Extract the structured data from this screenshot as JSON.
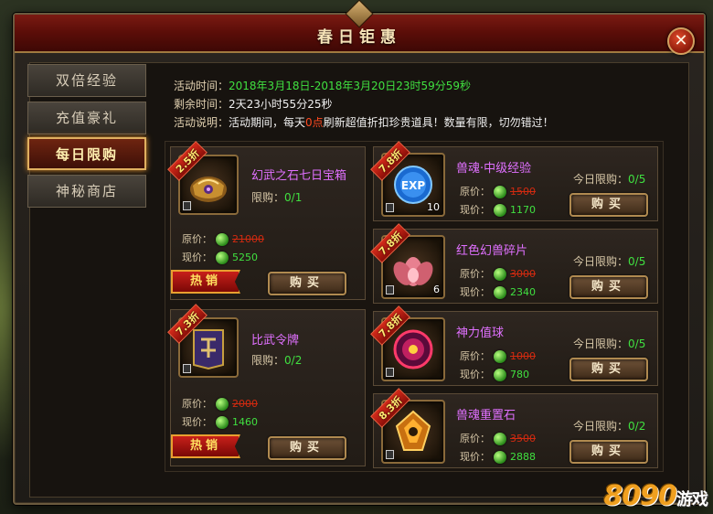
{
  "window": {
    "title": "春日钜惠",
    "close_label": "✕"
  },
  "tabs": [
    {
      "label": "双倍经验",
      "active": false
    },
    {
      "label": "充值豪礼",
      "active": false
    },
    {
      "label": "每日限购",
      "active": true
    },
    {
      "label": "神秘商店",
      "active": false
    }
  ],
  "info": {
    "time_label": "活动时间：",
    "time_value": "2018年3月18日-2018年3月20日23时59分59秒",
    "remain_label": "剩余时间：",
    "remain_value": "2天23小时55分25秒",
    "desc_label": "活动说明：",
    "desc_pre": "活动期间，每天",
    "desc_highlight": "0点",
    "desc_post": "刷新超值折扣珍贵道具！数量有限，切勿错过！"
  },
  "labels": {
    "original_price": "原价：",
    "current_price": "现价：",
    "buy": "购买",
    "hot": "热销",
    "limit_prefix": "限购：",
    "today_limit_prefix": "今日限购："
  },
  "big_items": [
    {
      "discount": "2.5折",
      "name": "幻武之石七日宝箱",
      "limit": "0/1",
      "original": "21000",
      "current": "5250",
      "hot": true,
      "icon": "treasure-chest-icon"
    },
    {
      "discount": "7.3折",
      "name": "比武令牌",
      "limit": "0/2",
      "original": "2000",
      "current": "1460",
      "hot": true,
      "icon": "token-icon"
    }
  ],
  "small_items": [
    {
      "discount": "7.8折",
      "name": "兽魂·中级经验",
      "limit": "0/5",
      "original": "1500",
      "current": "1170",
      "qty": "10",
      "icon": "exp-orb-icon"
    },
    {
      "discount": "7.8折",
      "name": "红色幻兽碎片",
      "limit": "0/5",
      "original": "3000",
      "current": "2340",
      "qty": "6",
      "icon": "lotus-shard-icon"
    },
    {
      "discount": "7.8折",
      "name": "神力值球",
      "limit": "0/5",
      "original": "1000",
      "current": "780",
      "qty": "",
      "icon": "power-orb-icon"
    },
    {
      "discount": "8.3折",
      "name": "兽魂重置石",
      "limit": "0/2",
      "original": "3500",
      "current": "2888",
      "qty": "",
      "icon": "reset-stone-icon"
    }
  ],
  "watermark": {
    "main": "8090",
    "sub": "游戏"
  }
}
